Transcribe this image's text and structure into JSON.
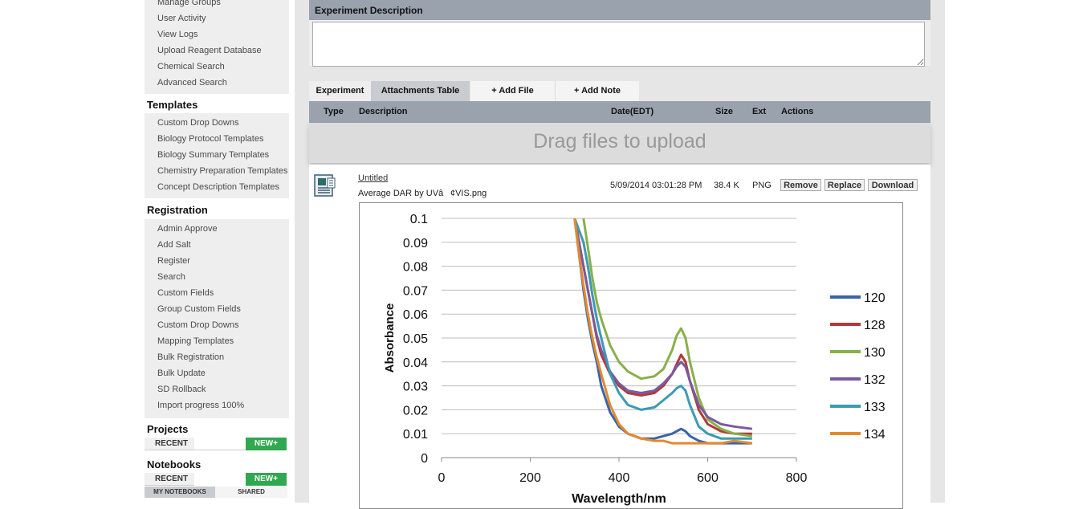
{
  "sidebar": {
    "top_items": [
      {
        "label": "Manage Groups"
      },
      {
        "label": "User Activity"
      },
      {
        "label": "View Logs"
      },
      {
        "label": "Upload Reagent Database"
      },
      {
        "label": "Chemical Search"
      },
      {
        "label": "Advanced Search"
      }
    ],
    "templates": {
      "title": "Templates",
      "items": [
        {
          "label": "Custom Drop Downs"
        },
        {
          "label": "Biology Protocol Templates"
        },
        {
          "label": "Biology Summary Templates"
        },
        {
          "label": "Chemistry Preparation Templates"
        },
        {
          "label": "Concept Description Templates"
        }
      ]
    },
    "registration": {
      "title": "Registration",
      "items": [
        {
          "label": "Admin Approve"
        },
        {
          "label": "Add Salt"
        },
        {
          "label": "Register"
        },
        {
          "label": "Search"
        },
        {
          "label": "Custom Fields"
        },
        {
          "label": "Group Custom Fields"
        },
        {
          "label": "Custom Drop Downs"
        },
        {
          "label": "Mapping Templates"
        },
        {
          "label": "Bulk Registration"
        },
        {
          "label": "Bulk Update"
        },
        {
          "label": "SD Rollback"
        },
        {
          "label": "Import progress 100%"
        }
      ]
    },
    "projects": {
      "title": "Projects",
      "recent_label": "RECENT",
      "new_label": "NEW+"
    },
    "notebooks": {
      "title": "Notebooks",
      "recent_label": "RECENT",
      "new_label": "NEW+",
      "tab_mine": "MY NOTEBOOKS",
      "tab_shared": "SHARED"
    }
  },
  "main": {
    "description_header": "Experiment Description",
    "description_value": "",
    "tabs": {
      "experiment": "Experiment",
      "attachments": "Attachments Table",
      "add_file": "+ Add File",
      "add_note": "+ Add Note"
    },
    "table_headers": {
      "type": "Type",
      "description": "Description",
      "date": "Date(EDT)",
      "size": "Size",
      "ext": "Ext",
      "actions": "Actions"
    },
    "dropzone_text": "Drag files to upload",
    "attachment": {
      "icon": "document-icon",
      "title": "Untitled",
      "filename": "Average DAR by UVâ¢VIS.png",
      "date": "5/09/2014 03:01:28 PM",
      "size": "38.4 K",
      "ext": "PNG",
      "actions": {
        "remove": "Remove",
        "replace": "Replace",
        "download": "Download"
      }
    }
  },
  "chart_data": {
    "type": "line",
    "xlabel": "Wavelength/nm",
    "ylabel": "Absorbance",
    "xlim": [
      0,
      800
    ],
    "ylim": [
      0,
      0.1
    ],
    "x_ticks": [
      "0",
      "200",
      "400",
      "600",
      "800"
    ],
    "y_ticks": [
      "0",
      "0.01",
      "0.02",
      "0.03",
      "0.04",
      "0.05",
      "0.06",
      "0.07",
      "0.08",
      "0.09",
      "0.1"
    ],
    "grid": "horizontal",
    "legend_position": "right",
    "series": [
      {
        "name": "120",
        "color": "#3a64a8",
        "x": [
          300,
          310,
          320,
          330,
          340,
          350,
          360,
          380,
          400,
          420,
          450,
          480,
          500,
          520,
          530,
          540,
          550,
          560,
          580,
          600,
          630,
          660,
          700
        ],
        "y": [
          0.1,
          0.085,
          0.07,
          0.058,
          0.048,
          0.04,
          0.03,
          0.019,
          0.013,
          0.01,
          0.008,
          0.008,
          0.009,
          0.01,
          0.011,
          0.012,
          0.011,
          0.009,
          0.007,
          0.006,
          0.006,
          0.006,
          0.006
        ]
      },
      {
        "name": "128",
        "color": "#b03a3a",
        "x": [
          300,
          310,
          320,
          330,
          340,
          350,
          360,
          380,
          400,
          420,
          450,
          480,
          500,
          520,
          530,
          540,
          550,
          560,
          580,
          600,
          630,
          660,
          700
        ],
        "y": [
          0.1,
          0.09,
          0.08,
          0.07,
          0.06,
          0.05,
          0.043,
          0.035,
          0.03,
          0.027,
          0.026,
          0.027,
          0.03,
          0.035,
          0.039,
          0.043,
          0.04,
          0.032,
          0.02,
          0.014,
          0.011,
          0.01,
          0.01
        ]
      },
      {
        "name": "130",
        "color": "#88b04b",
        "x": [
          300,
          310,
          320,
          330,
          340,
          350,
          360,
          380,
          400,
          420,
          450,
          480,
          500,
          520,
          530,
          540,
          550,
          560,
          580,
          600,
          630,
          660,
          700
        ],
        "y": [
          0.11,
          0.105,
          0.1,
          0.088,
          0.075,
          0.065,
          0.058,
          0.047,
          0.04,
          0.036,
          0.033,
          0.034,
          0.037,
          0.045,
          0.051,
          0.054,
          0.05,
          0.04,
          0.025,
          0.016,
          0.012,
          0.01,
          0.009
        ]
      },
      {
        "name": "132",
        "color": "#7a5a9e",
        "x": [
          300,
          310,
          320,
          330,
          340,
          350,
          360,
          380,
          400,
          420,
          450,
          480,
          500,
          520,
          530,
          540,
          550,
          560,
          580,
          600,
          630,
          660,
          700
        ],
        "y": [
          0.1,
          0.09,
          0.08,
          0.07,
          0.06,
          0.051,
          0.045,
          0.036,
          0.031,
          0.028,
          0.027,
          0.028,
          0.031,
          0.035,
          0.038,
          0.04,
          0.038,
          0.032,
          0.022,
          0.017,
          0.014,
          0.013,
          0.012
        ]
      },
      {
        "name": "133",
        "color": "#3d9ab3",
        "x": [
          300,
          310,
          320,
          330,
          340,
          350,
          360,
          380,
          400,
          420,
          450,
          480,
          500,
          520,
          530,
          540,
          550,
          560,
          580,
          600,
          630,
          660,
          700
        ],
        "y": [
          0.1,
          0.095,
          0.09,
          0.08,
          0.068,
          0.058,
          0.05,
          0.035,
          0.027,
          0.022,
          0.02,
          0.021,
          0.024,
          0.027,
          0.029,
          0.03,
          0.028,
          0.022,
          0.013,
          0.01,
          0.008,
          0.008,
          0.008
        ]
      },
      {
        "name": "134",
        "color": "#e38a2e",
        "x": [
          300,
          310,
          320,
          330,
          340,
          350,
          360,
          380,
          400,
          420,
          450,
          480,
          500,
          520,
          530,
          540,
          550,
          560,
          580,
          600,
          630,
          660,
          700
        ],
        "y": [
          0.1,
          0.085,
          0.072,
          0.06,
          0.05,
          0.042,
          0.035,
          0.022,
          0.014,
          0.01,
          0.008,
          0.007,
          0.007,
          0.006,
          0.006,
          0.006,
          0.006,
          0.006,
          0.006,
          0.006,
          0.006,
          0.007,
          0.006
        ]
      }
    ]
  }
}
